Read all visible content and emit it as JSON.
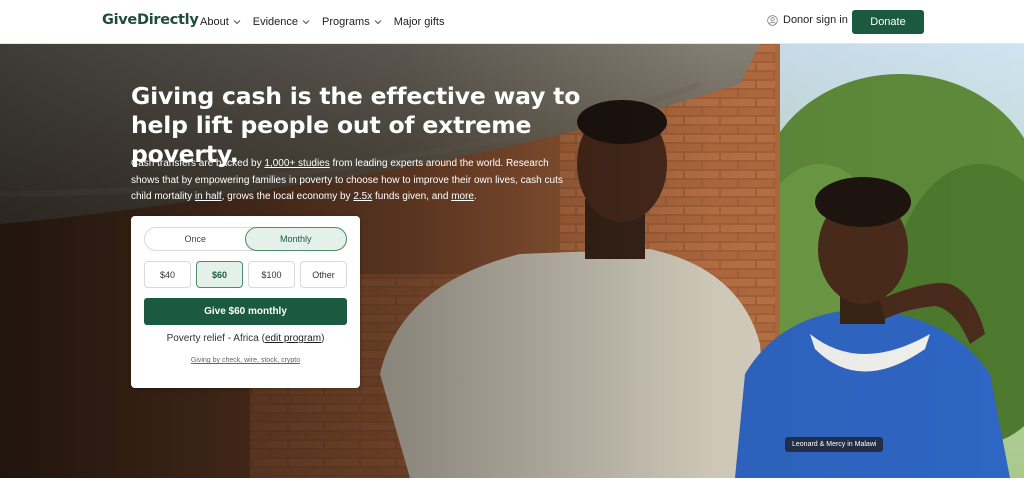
{
  "header": {
    "logo": "GiveDirectly",
    "nav": [
      {
        "label": "About",
        "has_menu": true
      },
      {
        "label": "Evidence",
        "has_menu": true
      },
      {
        "label": "Programs",
        "has_menu": true
      },
      {
        "label": "Major gifts",
        "has_menu": false
      }
    ],
    "signin_label": "Donor sign in",
    "donate_label": "Donate"
  },
  "hero": {
    "headline": "Giving cash is the effective way to help lift people out of extreme poverty.",
    "sub": {
      "p1": "Cash transfers are backed by ",
      "link1": "1,000+ studies",
      "p2": " from leading experts around the world. Research shows that by empowering families in poverty to choose how to improve their own lives, cash cuts child mortality ",
      "link2": "in half",
      "p3": ", grows the local economy by ",
      "link3": "2.5x",
      "p4": " funds given, and ",
      "link4": "more",
      "p5": "."
    },
    "caption": "Leonard & Mercy in Malawi"
  },
  "donate_card": {
    "frequency": [
      {
        "label": "Once",
        "selected": false
      },
      {
        "label": "Monthly",
        "selected": true
      }
    ],
    "amounts": [
      {
        "label": "$40",
        "selected": false
      },
      {
        "label": "$60",
        "selected": true
      },
      {
        "label": "$100",
        "selected": false
      },
      {
        "label": "Other",
        "selected": false
      }
    ],
    "give_button": "Give $60 monthly",
    "program_prefix": "Poverty relief - Africa (",
    "program_link": "edit program",
    "program_suffix": ")",
    "other_ways": "Giving by check, wire, stock, crypto"
  },
  "colors": {
    "brand_green": "#1b5a41",
    "selected_fill": "#e4f1ea",
    "selected_border": "#4b8d6d"
  }
}
